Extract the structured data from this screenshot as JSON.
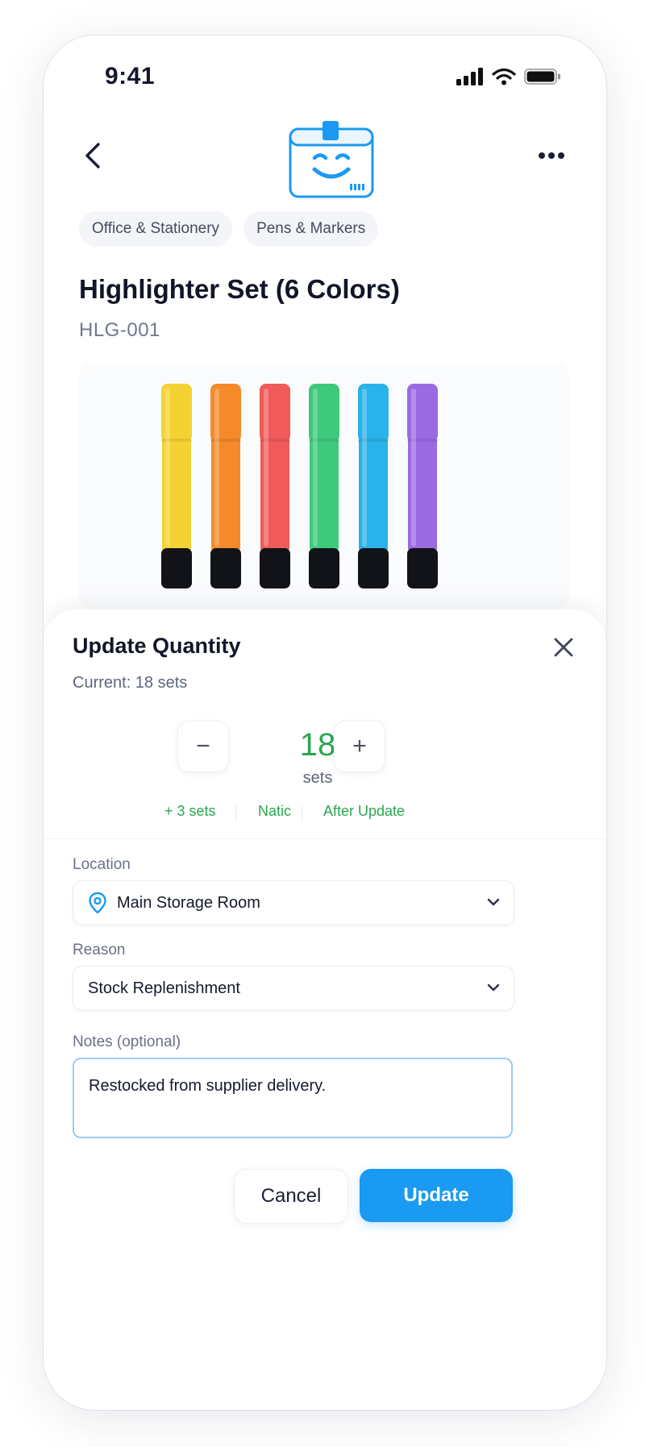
{
  "status_bar": {
    "time": "9:41"
  },
  "breadcrumbs": [
    "Office & Stationery",
    "Pens & Markers"
  ],
  "product": {
    "name": "Highlighter Set (6 Colors)",
    "sku": "HLG-001",
    "image_colors": [
      "#f5d233",
      "#f58a2a",
      "#f05a5a",
      "#3ec97c",
      "#29b3ea",
      "#9b6ae3"
    ]
  },
  "update_sheet": {
    "title": "Update Quantity",
    "current": "Current: 18 sets",
    "quantity": "18",
    "unit": "sets",
    "change": "+ 3 sets",
    "mode": "Natic",
    "after_label": "After Update",
    "location_label": "Location",
    "location_value": "Main Storage Room",
    "reason_label": "Reason",
    "reason_value": "Stock Replenishment",
    "notes_label": "Notes (optional)",
    "notes_value": "Restocked from supplier delivery.",
    "cancel_label": "Cancel",
    "update_label": "Update",
    "minus_symbol": "−",
    "plus_symbol": "+"
  },
  "icons": {
    "back": "chevron-left-icon",
    "more": "more-horizontal-icon",
    "close": "close-icon",
    "location": "location-pin-icon",
    "dropdown": "chevron-down-icon"
  },
  "colors": {
    "accent": "#1a9af2",
    "success": "#2aa650",
    "logo": "#1a9af2"
  }
}
